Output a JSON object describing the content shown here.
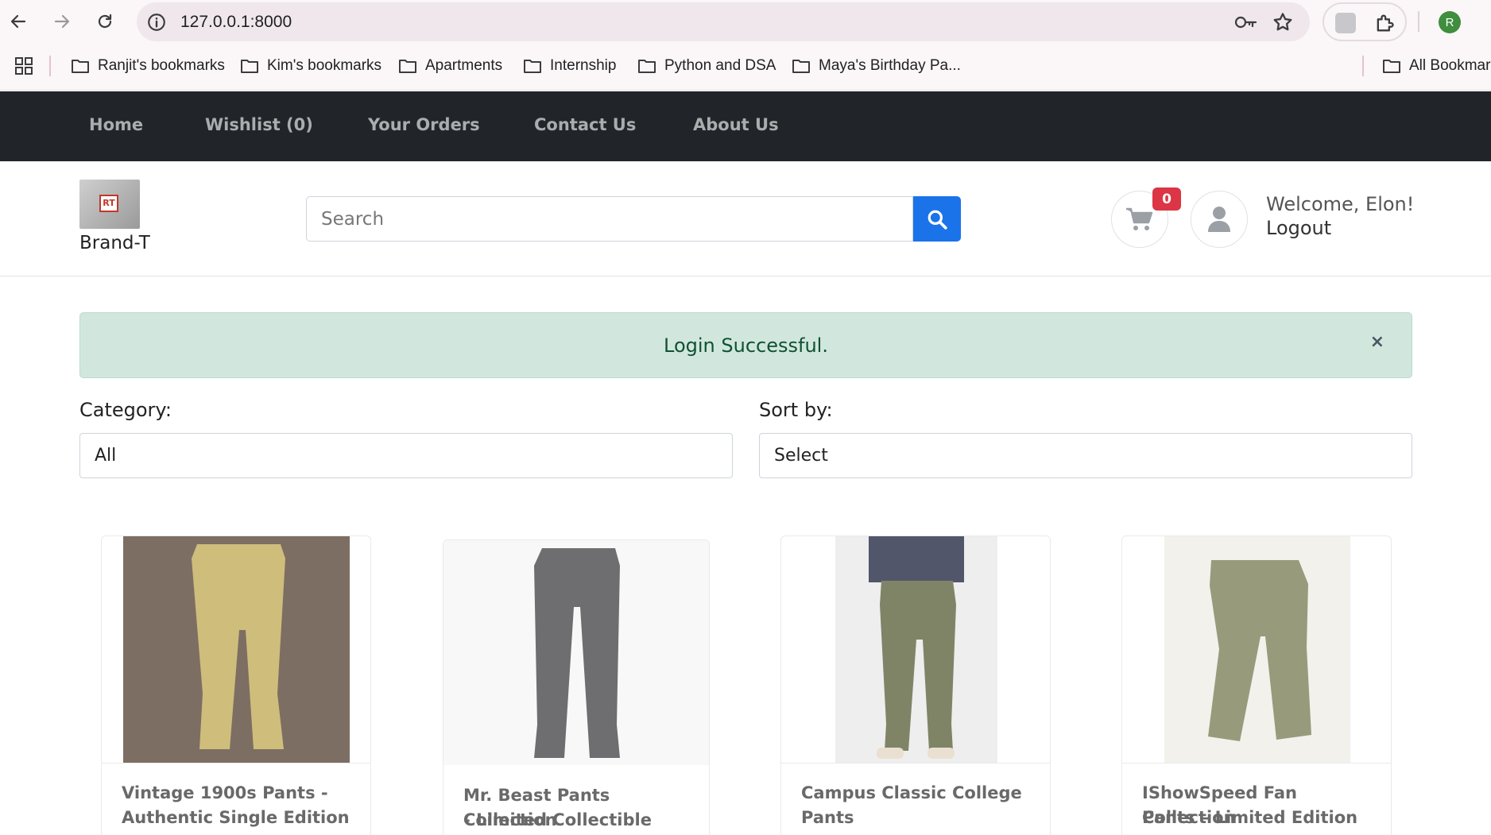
{
  "browser": {
    "url": "127.0.0.1:8000",
    "profile_initial": "R",
    "bookmarks": [
      {
        "label": "Ranjit's bookmarks"
      },
      {
        "label": "Kim's bookmarks"
      },
      {
        "label": "Apartments"
      },
      {
        "label": "Internship"
      },
      {
        "label": "Python and DSA"
      },
      {
        "label": "Maya's Birthday Pa..."
      }
    ],
    "all_bookmarks": "All Bookmarks"
  },
  "nav": {
    "items": [
      {
        "label": "Home"
      },
      {
        "label": "Wishlist (0)"
      },
      {
        "label": "Your Orders"
      },
      {
        "label": "Contact Us"
      },
      {
        "label": "About Us"
      }
    ]
  },
  "header": {
    "brand": "Brand-T",
    "logo_text": "RT",
    "search_placeholder": "Search",
    "cart_count": "0",
    "welcome": "Welcome, Elon!",
    "logout": "Logout"
  },
  "alert": {
    "message": "Login Successful.",
    "close": "×"
  },
  "filters": {
    "category_label": "Category:",
    "category_value": "All",
    "sort_label": "Sort by:",
    "sort_value": "Select"
  },
  "products": [
    {
      "title_line1": "Vintage 1900s Pants -",
      "title_line2": "Authentic Single Edition",
      "color": "#c9b46a"
    },
    {
      "title_line1": "Mr. Beast Pants Collection",
      "title_line2": "- Limited Collectible",
      "color": "#5b5b5e"
    },
    {
      "title_line1": "Campus Classic College",
      "title_line2": "Pants",
      "color": "#6e7352"
    },
    {
      "title_line1": "IShowSpeed Fan Collection",
      "title_line2": "Pants – Limited Edition",
      "color": "#8a8d6a"
    }
  ],
  "colors": {
    "navbar_bg": "#212529",
    "search_button": "#1a73e8",
    "alert_bg": "#d1e7dd",
    "alert_text": "#0f5132",
    "badge": "#dc3545"
  }
}
